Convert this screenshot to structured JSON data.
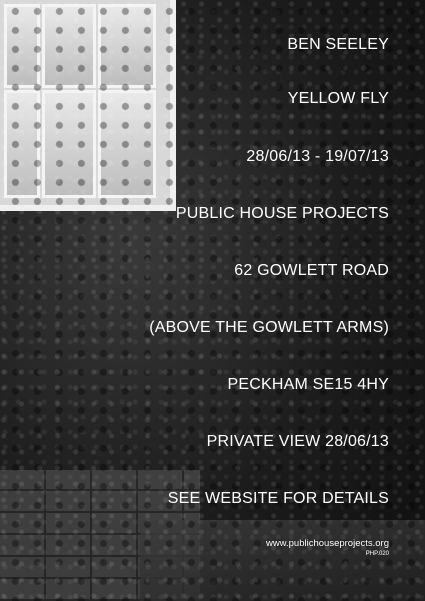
{
  "poster": {
    "lines": [
      "BEN SEELEY",
      "YELLOW FLY",
      "28/06/13 - 19/07/13",
      "PUBLIC HOUSE PROJECTS",
      "62 GOWLETT ROAD",
      "(ABOVE THE GOWLETT ARMS)",
      "PECKHAM SE15 4HY",
      "PRIVATE VIEW 28/06/13",
      "SEE WEBSITE FOR DETAILS"
    ],
    "website": "www.publichouseprojects.org",
    "code": "PHP.020"
  }
}
